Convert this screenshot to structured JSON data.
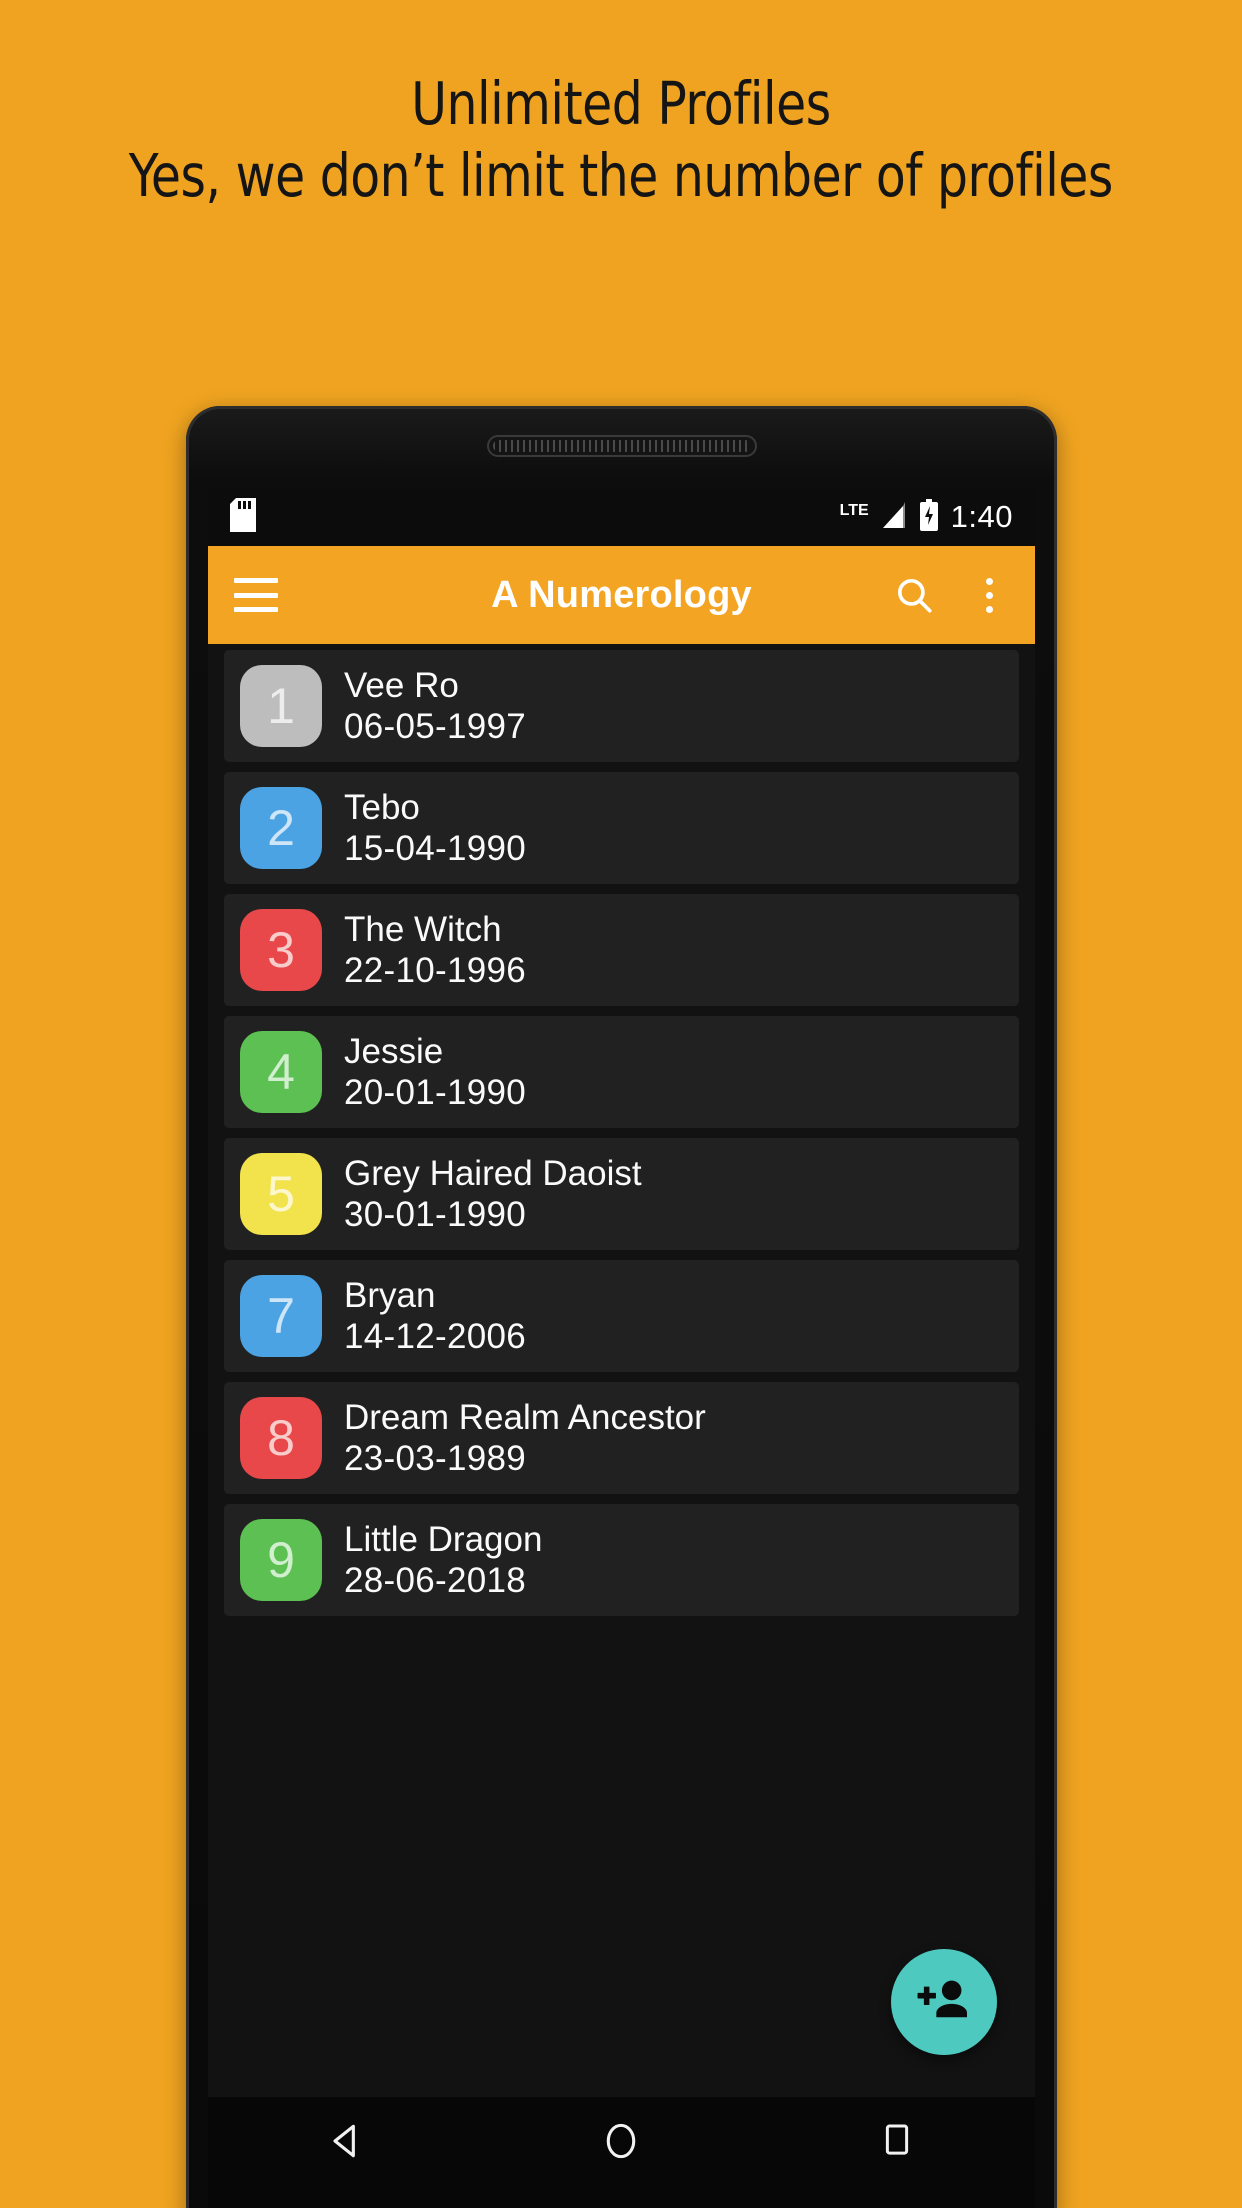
{
  "promo": {
    "line1": "Unlimited Profiles",
    "line2": "Yes, we don’t limit the number of profiles",
    "background_color": "#EFA320",
    "text_color": "#151515"
  },
  "device": {
    "frame_color": "#0a0a0a",
    "speaker_name": "earpiece-speaker"
  },
  "statusbar": {
    "sdcard_icon": "sd-card-icon",
    "network_label": "LTE",
    "signal_icon": "signal-bars-icon",
    "battery_icon": "battery-charging-icon",
    "time": "1:40",
    "background_color": "#0c0c0c"
  },
  "appbar": {
    "menu_icon": "hamburger-menu-icon",
    "title": "A Numerology",
    "search_icon": "search-icon",
    "overflow_icon": "overflow-menu-icon",
    "background_color": "#F4A423",
    "title_color": "#FFFFFF"
  },
  "list": {
    "background_color": "#121212",
    "card_color": "#212121",
    "items": [
      {
        "number": "1",
        "name": "Vee Ro",
        "date": "06-05-1997",
        "color": "#BDBDBD"
      },
      {
        "number": "2",
        "name": "Tebo",
        "date": "15-04-1990",
        "color": "#4BA3E3"
      },
      {
        "number": "3",
        "name": "The Witch",
        "date": "22-10-1996",
        "color": "#E8484A"
      },
      {
        "number": "4",
        "name": "Jessie",
        "date": "20-01-1990",
        "color": "#5CC052"
      },
      {
        "number": "5",
        "name": "Grey Haired Daoist",
        "date": "30-01-1990",
        "color": "#F2E34D"
      },
      {
        "number": "7",
        "name": "Bryan",
        "date": "14-12-2006",
        "color": "#4BA3E3"
      },
      {
        "number": "8",
        "name": "Dream Realm Ancestor",
        "date": "23-03-1989",
        "color": "#E8484A"
      },
      {
        "number": "9",
        "name": "Little Dragon",
        "date": "28-06-2018",
        "color": "#5CC052"
      }
    ]
  },
  "fab": {
    "icon": "person-add-icon",
    "background_color": "#4EC9C0"
  },
  "navbar": {
    "back_icon": "back-triangle-icon",
    "home_icon": "home-circle-icon",
    "recents_icon": "recents-square-icon",
    "background_color": "#070707"
  }
}
